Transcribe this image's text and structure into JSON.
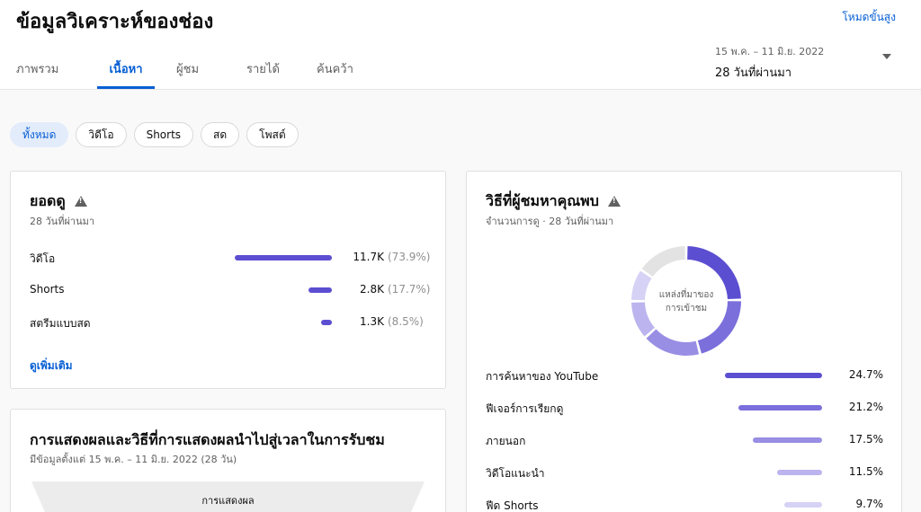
{
  "header": {
    "title": "ข้อมูลวิเคราะห์ของช่อง",
    "advanced_mode": "โหมดขั้นสูง",
    "tabs": [
      "ภาพรวม",
      "เนื้อหา",
      "ผู้ชม",
      "รายได้",
      "ค้นคว้า"
    ],
    "active_tab": "เนื้อหา",
    "date_range": "15 พ.ค. – 11 มิ.ย. 2022",
    "period": "28 วันที่ผ่านมา"
  },
  "filters": {
    "chips": [
      "ทั้งหมด",
      "วิดีโอ",
      "Shorts",
      "สด",
      "โพสต์"
    ],
    "active": "ทั้งหมด"
  },
  "views_card": {
    "title": "ยอดดู",
    "subtitle": "28 วันที่ผ่านมา",
    "rows": [
      {
        "label": "วิดีโอ",
        "value": "11.7K",
        "pct": "(73.9%)",
        "share": 0.739
      },
      {
        "label": "Shorts",
        "value": "2.8K",
        "pct": "(17.7%)",
        "share": 0.177
      },
      {
        "label": "สตรีมแบบสด",
        "value": "1.3K",
        "pct": "(8.5%)",
        "share": 0.085
      }
    ],
    "more": "ดูเพิ่มเติม"
  },
  "sources_card": {
    "title": "วิธีที่ผู้ชมหาคุณพบ",
    "subtitle": "จำนวนการดู · 28 วันที่ผ่านมา",
    "donut_center": [
      "แหล่งที่มาของ",
      "การเข้าชม"
    ],
    "rows": [
      {
        "label": "การค้นหาของ YouTube",
        "pct": "24.7%",
        "value": 24.7,
        "color": "#5c4ed1"
      },
      {
        "label": "ฟีเจอร์การเรียกดู",
        "pct": "21.2%",
        "value": 21.2,
        "color": "#7b6fdc"
      },
      {
        "label": "ภายนอก",
        "pct": "17.5%",
        "value": 17.5,
        "color": "#988ee4"
      },
      {
        "label": "วิดีโอแนะนำ",
        "pct": "11.5%",
        "value": 11.5,
        "color": "#bbb4ee"
      },
      {
        "label": "ฟีด Shorts",
        "pct": "9.7%",
        "value": 9.7,
        "color": "#d6d2f5"
      }
    ],
    "other_share": 15.4,
    "other_color": "#e3e3e3"
  },
  "impressions_card": {
    "title": "การแสดงผลและวิธีที่การแสดงผลนำไปสู่เวลาในการรับชม",
    "subtitle": "มีข้อมูลตั้งแต่ 15 พ.ค. – 11 มิ.ย. 2022 (28 วัน)",
    "funnel_label": "การแสดงผล"
  }
}
